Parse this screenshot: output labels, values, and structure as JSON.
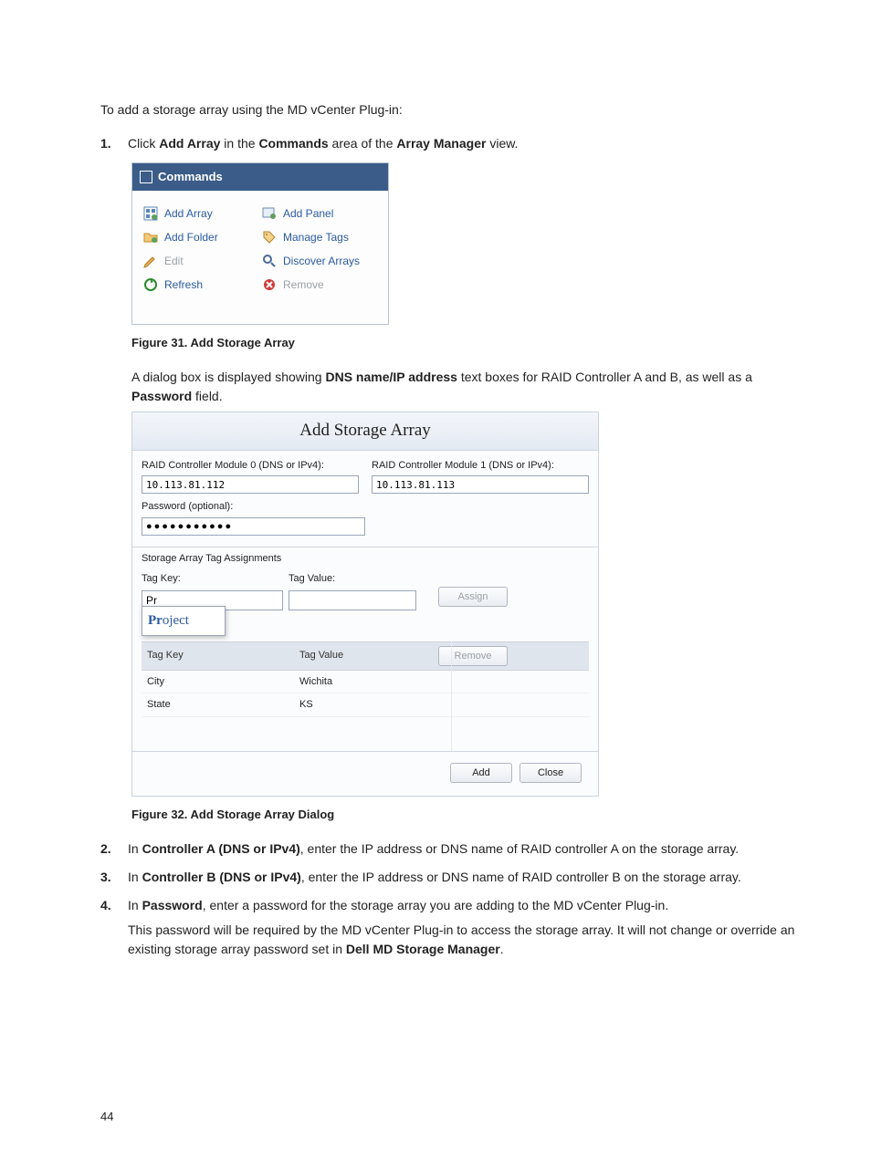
{
  "intro": "To add a storage array using the MD vCenter Plug-in:",
  "step1": {
    "num": "1.",
    "prefix": "Click ",
    "b1": "Add Array",
    "mid1": " in the ",
    "b2": "Commands",
    "mid2": " area of the ",
    "b3": "Array Manager",
    "suffix": " view."
  },
  "cmdPanel": {
    "title": "Commands",
    "items": {
      "addArray": "Add Array",
      "addFolder": "Add Folder",
      "edit": "Edit",
      "refresh": "Refresh",
      "addPanel": "Add Panel",
      "manageTags": "Manage Tags",
      "discover": "Discover Arrays",
      "remove": "Remove"
    }
  },
  "fig31": "Figure 31. Add Storage Array",
  "para1": {
    "prefix": "A dialog box is displayed showing ",
    "b1": "DNS name/IP address",
    "mid1": " text boxes for RAID Controller A and B, as well as a ",
    "b2": "Password",
    "suffix": " field."
  },
  "dialog": {
    "title": "Add Storage Array",
    "ctrl0Label": "RAID Controller Module 0 (DNS or IPv4):",
    "ctrl0Value": "10.113.81.112",
    "ctrl1Label": "RAID Controller Module 1 (DNS or IPv4):",
    "ctrl1Value": "10.113.81.113",
    "pwLabel": "Password (optional):",
    "pwValue": "●●●●●●●●●●●",
    "tagSection": "Storage Array Tag Assignments",
    "tagKeyLabel": "Tag Key:",
    "tagValLabel": "Tag Value:",
    "tagKeyInput": "Pr",
    "autoBold": "Pr",
    "autoRest": "oject",
    "assignBtn": "Assign",
    "tableKeyHead": "Tag Key",
    "tableValHead": "Tag Value",
    "removeBtn": "Remove",
    "rows": [
      {
        "key": "City",
        "val": "Wichita"
      },
      {
        "key": "State",
        "val": "KS"
      }
    ],
    "addBtn": "Add",
    "closeBtn": "Close"
  },
  "fig32": "Figure 32. Add Storage Array Dialog",
  "step2": {
    "num": "2.",
    "p": "In ",
    "b": "Controller A (DNS or IPv4)",
    "s": ", enter the IP address or DNS name of RAID controller A on the storage array."
  },
  "step3": {
    "num": "3.",
    "p": "In ",
    "b": "Controller B (DNS or IPv4)",
    "s": ", enter the IP address or DNS name of RAID controller B on the storage array."
  },
  "step4": {
    "num": "4.",
    "line1p": "In ",
    "line1b": "Password",
    "line1s": ", enter a password for the storage array you are adding to the MD vCenter Plug-in.",
    "line2p": "This password will be required by the MD vCenter Plug-in to access the storage array. It will not change or override an existing storage array password set in ",
    "line2b": "Dell MD Storage Manager",
    "line2s": "."
  },
  "pageNum": "44"
}
